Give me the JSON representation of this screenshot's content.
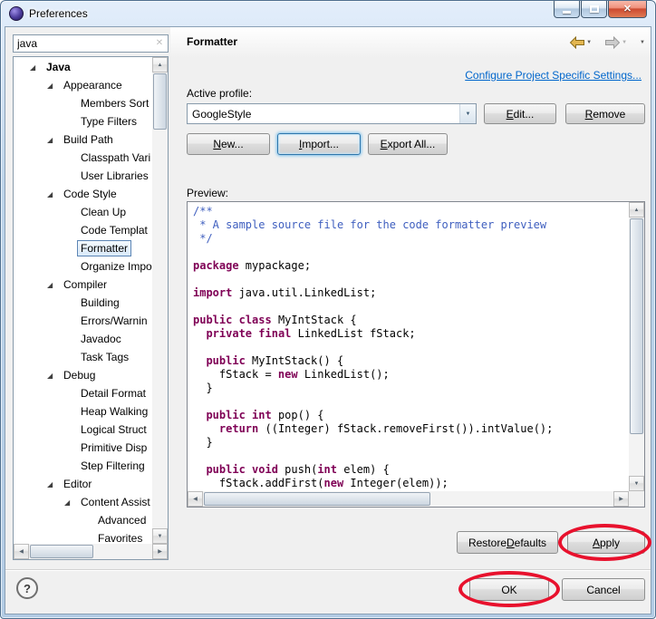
{
  "window": {
    "title": "Preferences"
  },
  "icons": {
    "close": "✕",
    "clear_filter": "✕",
    "combo_arrow": "▼",
    "menu_caret": "▼",
    "scroll_up": "▲",
    "scroll_down": "▼",
    "scroll_left": "◀",
    "scroll_right": "▶",
    "expander_expanded": "◢"
  },
  "colors": {
    "keyword": "#7f0055",
    "comment": "#3f5fbf",
    "link": "#0066cc",
    "annotation": "#e8112d"
  },
  "sidebar": {
    "search_value": "java",
    "tree": [
      {
        "label": "Java",
        "level": 0,
        "expanded": true,
        "bold": true
      },
      {
        "label": "Appearance",
        "level": 1,
        "expanded": true
      },
      {
        "label": "Members Sort",
        "level": 2
      },
      {
        "label": "Type Filters",
        "level": 2
      },
      {
        "label": "Build Path",
        "level": 1,
        "expanded": true
      },
      {
        "label": "Classpath Vari",
        "level": 2
      },
      {
        "label": "User Libraries",
        "level": 2
      },
      {
        "label": "Code Style",
        "level": 1,
        "expanded": true
      },
      {
        "label": "Clean Up",
        "level": 2
      },
      {
        "label": "Code Templat",
        "level": 2
      },
      {
        "label": "Formatter",
        "level": 2,
        "selected": true
      },
      {
        "label": "Organize Impo",
        "level": 2
      },
      {
        "label": "Compiler",
        "level": 1,
        "expanded": true
      },
      {
        "label": "Building",
        "level": 2
      },
      {
        "label": "Errors/Warnin",
        "level": 2
      },
      {
        "label": "Javadoc",
        "level": 2
      },
      {
        "label": "Task Tags",
        "level": 2
      },
      {
        "label": "Debug",
        "level": 1,
        "expanded": true
      },
      {
        "label": "Detail Format",
        "level": 2
      },
      {
        "label": "Heap Walking",
        "level": 2
      },
      {
        "label": "Logical Struct",
        "level": 2
      },
      {
        "label": "Primitive Disp",
        "level": 2
      },
      {
        "label": "Step Filtering",
        "level": 2
      },
      {
        "label": "Editor",
        "level": 1,
        "expanded": true
      },
      {
        "label": "Content Assist",
        "level": 2,
        "expanded": true
      },
      {
        "label": "Advanced",
        "level": 3
      },
      {
        "label": "Favorites",
        "level": 3
      }
    ]
  },
  "page": {
    "title": "Formatter",
    "configure_link": "Configure Project Specific Settings...",
    "active_profile_label": "Active profile:",
    "profile_value": "GoogleStyle",
    "buttons": {
      "edit": {
        "label": "Edit...",
        "mnemonic": "E"
      },
      "remove": {
        "label": "Remove",
        "mnemonic": "R"
      },
      "new": {
        "label": "New...",
        "mnemonic": "N"
      },
      "import": {
        "label": "Import...",
        "mnemonic": "I"
      },
      "export_all": {
        "label": "Export All...",
        "mnemonic": "E"
      },
      "restore_defaults": {
        "label": "Restore Defaults",
        "mnemonic": "D"
      },
      "apply": {
        "label": "Apply",
        "mnemonic": "A"
      }
    },
    "preview_label": "Preview:",
    "preview_code": [
      [
        [
          "c",
          "/**"
        ]
      ],
      [
        [
          "c",
          " * A sample source file for the code formatter preview"
        ]
      ],
      [
        [
          "c",
          " */"
        ]
      ],
      [],
      [
        [
          "k",
          "package"
        ],
        [
          "p",
          " mypackage;"
        ]
      ],
      [],
      [
        [
          "k",
          "import"
        ],
        [
          "p",
          " java.util.LinkedList;"
        ]
      ],
      [],
      [
        [
          "k",
          "public"
        ],
        [
          "p",
          " "
        ],
        [
          "k",
          "class"
        ],
        [
          "p",
          " MyIntStack {"
        ]
      ],
      [
        [
          "p",
          "  "
        ],
        [
          "k",
          "private"
        ],
        [
          "p",
          " "
        ],
        [
          "k",
          "final"
        ],
        [
          "p",
          " LinkedList fStack;"
        ]
      ],
      [],
      [
        [
          "p",
          "  "
        ],
        [
          "k",
          "public"
        ],
        [
          "p",
          " MyIntStack() {"
        ]
      ],
      [
        [
          "p",
          "    fStack = "
        ],
        [
          "k",
          "new"
        ],
        [
          "p",
          " LinkedList();"
        ]
      ],
      [
        [
          "p",
          "  }"
        ]
      ],
      [],
      [
        [
          "p",
          "  "
        ],
        [
          "k",
          "public"
        ],
        [
          "p",
          " "
        ],
        [
          "k",
          "int"
        ],
        [
          "p",
          " pop() {"
        ]
      ],
      [
        [
          "p",
          "    "
        ],
        [
          "k",
          "return"
        ],
        [
          "p",
          " ((Integer) fStack.removeFirst()).intValue();"
        ]
      ],
      [
        [
          "p",
          "  }"
        ]
      ],
      [],
      [
        [
          "p",
          "  "
        ],
        [
          "k",
          "public"
        ],
        [
          "p",
          " "
        ],
        [
          "k",
          "void"
        ],
        [
          "p",
          " push("
        ],
        [
          "k",
          "int"
        ],
        [
          "p",
          " elem) {"
        ]
      ],
      [
        [
          "p",
          "    fStack.addFirst("
        ],
        [
          "k",
          "new"
        ],
        [
          "p",
          " Integer(elem));"
        ]
      ],
      [
        [
          "p",
          "  }"
        ]
      ]
    ]
  },
  "footer": {
    "help": "?",
    "ok": "OK",
    "cancel": "Cancel"
  }
}
